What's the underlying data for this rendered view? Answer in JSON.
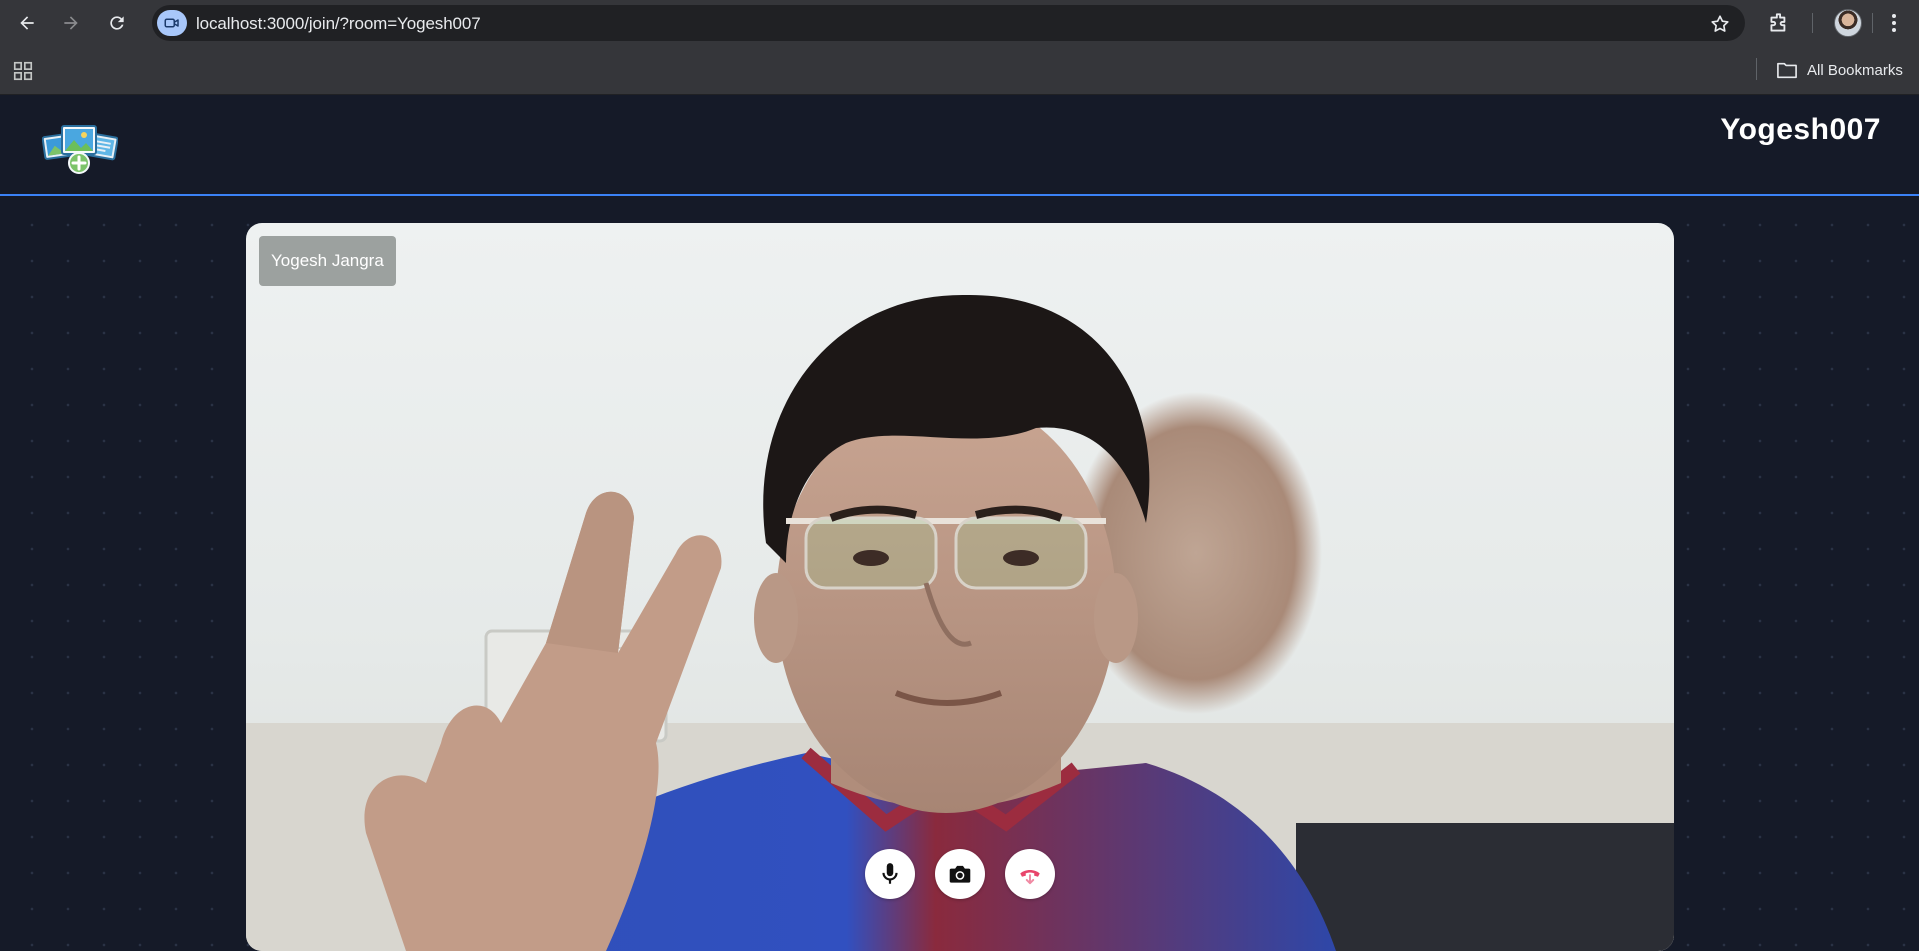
{
  "browser": {
    "url": "localhost:3000/join/?room=Yogesh007",
    "bookmarks_label": "All Bookmarks"
  },
  "app": {
    "room_name": "Yogesh007",
    "participant_name": "Yogesh Jangra",
    "accent_color": "#3b82f6",
    "end_call_color": "#e8456b",
    "controls": [
      "mic-icon",
      "camera-icon",
      "end-call-icon"
    ]
  }
}
